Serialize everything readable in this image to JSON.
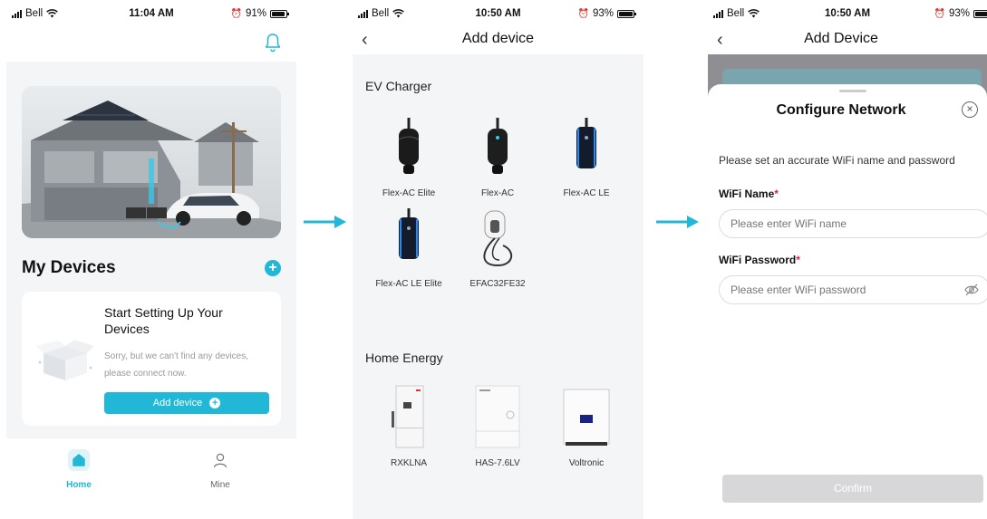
{
  "colors": {
    "accent": "#20b8d6",
    "required": "#e0243a"
  },
  "screen_home": {
    "status": {
      "carrier": "Bell",
      "time": "11:04 AM",
      "battery": "91%"
    },
    "header_icon": "bell-icon",
    "section_title": "My Devices",
    "empty_card": {
      "title": "Start Setting Up Your Devices",
      "description": "Sorry, but we can't find any devices, please connect now.",
      "button_label": "Add device"
    },
    "tabs": [
      {
        "label": "Home",
        "icon": "home-icon",
        "active": true
      },
      {
        "label": "Mine",
        "icon": "user-icon",
        "active": false
      }
    ]
  },
  "screen_add_device": {
    "status": {
      "carrier": "Bell",
      "time": "10:50 AM",
      "battery": "93%"
    },
    "title": "Add device",
    "ev_section_title": "EV Charger",
    "ev_devices": [
      "Flex-AC Elite",
      "Flex-AC",
      "Flex-AC LE",
      "Flex-AC LE Elite",
      "EFAC32FE32"
    ],
    "home_section_title": "Home Energy",
    "home_devices": [
      "RXKLNA",
      "HAS-7.6LV",
      "Voltronic"
    ]
  },
  "screen_configure": {
    "status": {
      "carrier": "Bell",
      "time": "10:50 AM",
      "battery": "93%"
    },
    "title": "Add Device",
    "sheet_title": "Configure Network",
    "instruction": "Please set an accurate WiFi name and password",
    "wifi_name_label": "WiFi Name",
    "wifi_name_placeholder": "Please enter WiFi name",
    "wifi_password_label": "WiFi Password",
    "wifi_password_placeholder": "Please enter WiFi password",
    "required_mark": "*",
    "confirm_label": "Confirm"
  }
}
